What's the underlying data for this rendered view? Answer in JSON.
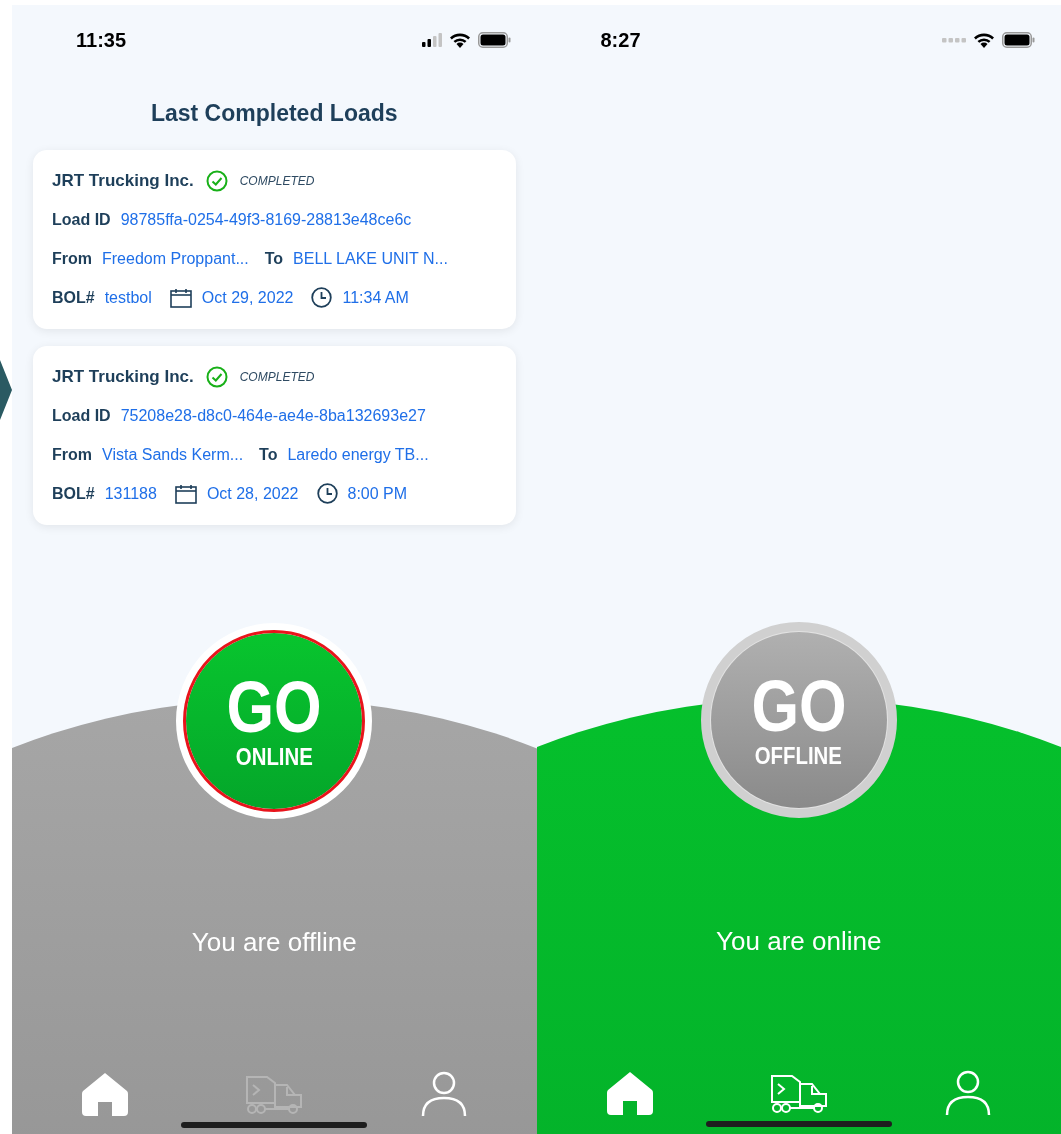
{
  "screens": [
    {
      "status_bar": {
        "time": "11:35",
        "kind": "bars"
      },
      "title": "Last Completed Loads",
      "loads": [
        {
          "company": "JRT Trucking Inc.",
          "status": "COMPLETED",
          "load_id_label": "Load ID",
          "load_id": "98785ffa-0254-49f3-8169-28813e48ce6c",
          "from_label": "From",
          "from": "Freedom Proppant...",
          "to_label": "To",
          "to": "BELL LAKE UNIT N...",
          "bol_label": "BOL#",
          "bol": "testbol",
          "date": "Oct 29, 2022",
          "time": "11:34 AM"
        },
        {
          "company": "JRT Trucking Inc.",
          "status": "COMPLETED",
          "load_id_label": "Load ID",
          "load_id": "75208e28-d8c0-464e-ae4e-8ba132693e27",
          "from_label": "From",
          "from": "Vista Sands Kerm...",
          "to_label": "To",
          "to": "Laredo energy TB...",
          "bol_label": "BOL#",
          "bol": "131188",
          "date": "Oct 28, 2022",
          "time": "8:00 PM"
        }
      ],
      "online": false,
      "go_button": {
        "top": "GO",
        "bottom": "ONLINE"
      },
      "status_text": "You are offline",
      "nav": [
        {
          "kind": "home",
          "disabled": false
        },
        {
          "kind": "truck",
          "disabled": true
        },
        {
          "kind": "profile",
          "disabled": false
        }
      ]
    },
    {
      "status_bar": {
        "time": "8:27",
        "kind": "none"
      },
      "online": true,
      "go_button": {
        "top": "GO",
        "bottom": "OFFLINE"
      },
      "status_text": "You are online",
      "nav": [
        {
          "kind": "home",
          "disabled": false
        },
        {
          "kind": "truck",
          "disabled": false
        },
        {
          "kind": "profile",
          "disabled": false
        }
      ]
    }
  ]
}
